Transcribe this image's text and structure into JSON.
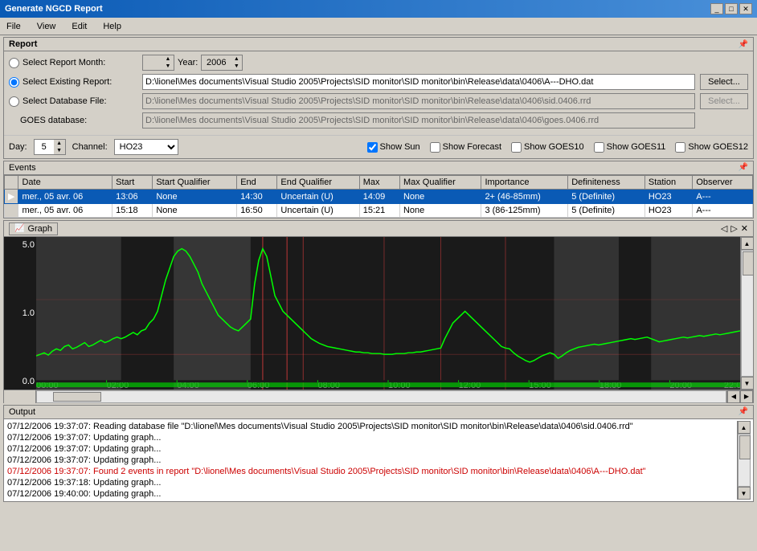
{
  "titleBar": {
    "title": "Generate NGCD Report",
    "closeBtn": "✕",
    "minimizeBtn": "_",
    "maximizeBtn": "□"
  },
  "menuBar": {
    "items": [
      "File",
      "View",
      "Edit",
      "Help"
    ]
  },
  "report": {
    "panelTitle": "Report",
    "selectMonthLabel": "Select Report Month:",
    "yearLabel": "Year:",
    "yearValue": "2006",
    "selectExistingLabel": "Select Existing Report:",
    "existingPath": "D:\\lionel\\Mes documents\\Visual Studio 2005\\Projects\\SID monitor\\SID monitor\\bin\\Release\\data\\0406\\A---DHO.dat",
    "selectDbLabel": "Select Database File:",
    "dbPath": "D:\\lionel\\Mes documents\\Visual Studio 2005\\Projects\\SID monitor\\SID monitor\\bin\\Release\\data\\0406\\sid.0406.rrd",
    "goesLabel": "GOES database:",
    "goesPath": "D:\\lionel\\Mes documents\\Visual Studio 2005\\Projects\\SID monitor\\SID monitor\\bin\\Release\\data\\0406\\goes.0406.rrd",
    "selectBtnLabel": "Select...",
    "selectBtnDisabled": "Select...",
    "dayLabel": "Day:",
    "dayValue": "5",
    "channelLabel": "Channel:",
    "channelValue": "HO23",
    "checkboxes": {
      "showSun": {
        "label": "Show Sun",
        "checked": true
      },
      "showForecast": {
        "label": "Show Forecast",
        "checked": false
      },
      "showGOES10": {
        "label": "Show GOES10",
        "checked": false
      },
      "showGOES11": {
        "label": "Show GOES11",
        "checked": false
      },
      "showGOES12": {
        "label": "Show GOES12",
        "checked": false
      }
    }
  },
  "events": {
    "panelTitle": "Events",
    "columns": [
      "Date",
      "Start",
      "Start Qualifier",
      "End",
      "End Qualifier",
      "Max",
      "Max Qualifier",
      "Importance",
      "Definiteness",
      "Station",
      "Observer"
    ],
    "rows": [
      {
        "selected": true,
        "arrow": "▶",
        "date": "mer., 05 avr. 06",
        "start": "13:06",
        "startQual": "None",
        "end": "14:30",
        "endQual": "Uncertain (U)",
        "max": "14:09",
        "maxQual": "None",
        "importance": "2+ (46-85mm)",
        "definiteness": "5 (Definite)",
        "station": "HO23",
        "observer": "A---"
      },
      {
        "selected": false,
        "arrow": "",
        "date": "mer., 05 avr. 06",
        "start": "15:18",
        "startQual": "None",
        "end": "16:50",
        "endQual": "Uncertain (U)",
        "max": "15:21",
        "maxQual": "None",
        "importance": "3 (86-125mm)",
        "definiteness": "5 (Definite)",
        "station": "HO23",
        "observer": "A---"
      }
    ]
  },
  "graph": {
    "panelTitle": "Graph",
    "tabIcon": "📈",
    "yAxisLabels": [
      "5.0",
      "1.0",
      "0.0"
    ],
    "navIcons": [
      "◁",
      "▷",
      "✕"
    ]
  },
  "output": {
    "panelTitle": "Output",
    "lines": [
      {
        "text": "07/12/2006 19:37:07:  Reading database file \"D:\\lionel\\Mes documents\\Visual Studio 2005\\Projects\\SID monitor\\SID monitor\\bin\\Release\\data\\0406\\sid.0406.rrd\"",
        "highlight": false
      },
      {
        "text": "07/12/2006 19:37:07:  Updating graph...",
        "highlight": false
      },
      {
        "text": "07/12/2006 19:37:07:  Updating graph...",
        "highlight": false
      },
      {
        "text": "07/12/2006 19:37:07:  Updating graph...",
        "highlight": false
      },
      {
        "text": "07/12/2006 19:37:07:  Found 2 events in report \"D:\\lionel\\Mes documents\\Visual Studio 2005\\Projects\\SID monitor\\SID monitor\\bin\\Release\\data\\0406\\A---DHO.dat\"",
        "highlight": true
      },
      {
        "text": "07/12/2006 19:37:18:  Updating graph...",
        "highlight": false
      },
      {
        "text": "07/12/2006 19:40:00:  Updating graph...",
        "highlight": false
      }
    ]
  }
}
